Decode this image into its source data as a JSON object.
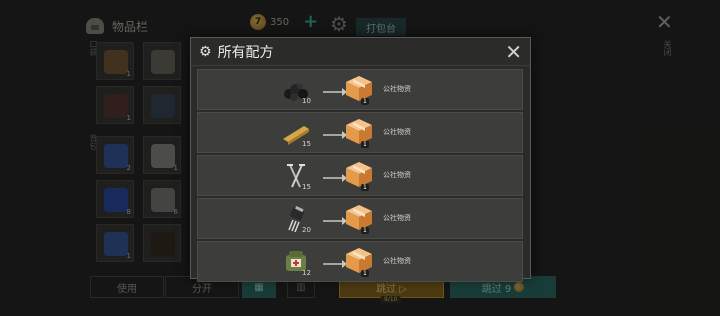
{
  "inventory": {
    "title": "物品栏",
    "coins": "350",
    "coin_symbol": "7",
    "pack_table": "打包台",
    "side_label_top": "口袋",
    "side_label_bottom": "背包",
    "slots": [
      {
        "name": "leather-slot",
        "qty": "1",
        "color": "#7a5a3a"
      },
      {
        "name": "spiked-club-slot",
        "qty": "",
        "color": "#6d6a60"
      },
      {
        "name": "armor-vest-slot",
        "qty": "1",
        "color": "#5a3a36"
      },
      {
        "name": "pants-slot",
        "qty": "",
        "color": "#3a4a5a"
      },
      {
        "name": "glue-slot",
        "qty": "2",
        "color": "#3a5aa0"
      },
      {
        "name": "wrench-slot",
        "qty": "1",
        "color": "#8a8a86"
      },
      {
        "name": "duct-tape-slot",
        "qty": "8",
        "color": "#2c4ea8"
      },
      {
        "name": "bolts-slot",
        "qty": "6",
        "color": "#7c7c78"
      },
      {
        "name": "usb-slot",
        "qty": "1",
        "color": "#3a5a9a"
      },
      {
        "name": "dog-slot",
        "qty": "",
        "color": "#3a2e24"
      }
    ]
  },
  "close_label": "关闭",
  "bottom_bar": {
    "use": "使用",
    "split": "分开",
    "grid_icon": "▦",
    "trash_icon": "▥",
    "skip_ad": "跳过 ▷",
    "skip_ad_sub": "9/10",
    "skip_coin": "跳过 9"
  },
  "modal": {
    "title": "所有配方",
    "recipes": [
      {
        "ingredient": "coal-icon",
        "qty": "10",
        "result_qty": "1",
        "result_name": "公社物资"
      },
      {
        "ingredient": "wood-plank-icon",
        "qty": "15",
        "result_qty": "1",
        "result_name": "公社物资"
      },
      {
        "ingredient": "nails-icon",
        "qty": "15",
        "result_qty": "1",
        "result_name": "公社物资"
      },
      {
        "ingredient": "transistor-icon",
        "qty": "20",
        "result_qty": "1",
        "result_name": "公社物资"
      },
      {
        "ingredient": "first-aid-pack-icon",
        "qty": "12",
        "result_qty": "1",
        "result_name": "公社物资"
      }
    ]
  },
  "colors": {
    "accent_teal": "#2e6e66",
    "accent_gold": "#8a6a20",
    "box_orange": "#e39a4a"
  }
}
